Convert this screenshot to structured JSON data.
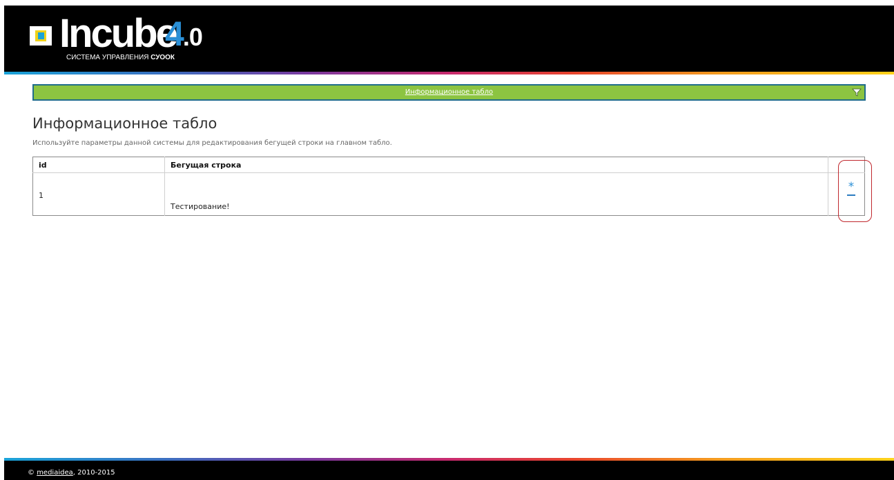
{
  "header": {
    "logo_word": "Incube",
    "logo_version_major": "4",
    "logo_version_minor": ".0",
    "logo_subtitle_prefix": "СИСТЕМА УПРАВЛЕНИЯ",
    "logo_subtitle_brand": "СУООК"
  },
  "nav": {
    "link_label": "Информационное табло",
    "filter_icon": "filter-funnel-icon"
  },
  "main": {
    "title": "Информационное табло",
    "description": "Используйте параметры данной системы для редактирования бегущей строки на главном табло.",
    "table": {
      "columns": [
        "id",
        "Бегущая строка"
      ],
      "rows": [
        {
          "id": "1",
          "text": "Тестирование!"
        }
      ],
      "row_actions": {
        "edit_symbol": "*",
        "edit_icon": "asterisk-edit-icon",
        "delete_icon": "minus-delete-icon"
      }
    }
  },
  "footer": {
    "copyright": "©",
    "link_text": "mediaidea",
    "years": ", 2010-2015"
  },
  "colors": {
    "header_bg": "#000000",
    "nav_green": "#8cc441",
    "nav_border": "#1f6c8a",
    "accent_blue": "#2a8fd6",
    "highlight_red": "#c0272d"
  }
}
